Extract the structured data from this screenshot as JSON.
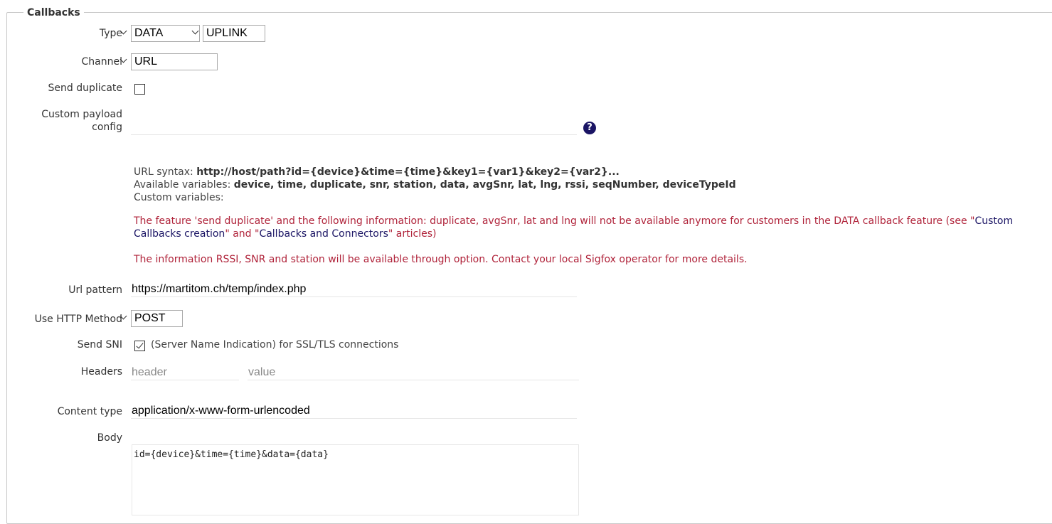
{
  "section": {
    "title": "Callbacks"
  },
  "type": {
    "label": "Type",
    "value1": "DATA",
    "value2": "UPLINK"
  },
  "channel": {
    "label": "Channel",
    "value": "URL"
  },
  "send_duplicate": {
    "label": "Send duplicate",
    "checked": false
  },
  "custom_payload": {
    "label_line1": "Custom payload",
    "label_line2": "config",
    "value": "",
    "help_icon": "question-circle-icon",
    "help_glyph": "?"
  },
  "info": {
    "url_syntax_label": "URL syntax:",
    "url_syntax_value": "http://host/path?id={device}&time={time}&key1={var1}&key2={var2}...",
    "available_label": "Available variables:",
    "available_value": "device, time, duplicate, snr, station, data, avgSnr, lat, lng, rssi, seqNumber, deviceTypeId",
    "custom_label": "Custom variables:"
  },
  "warnings": {
    "w1_part1": "The feature 'send duplicate' and the following information: duplicate, avgSnr, lat and lng will not be available anymore for customers in the DATA callback feature (see \"",
    "w1_link1": "Custom Callbacks creation",
    "w1_part2": "\" and \"",
    "w1_link2": "Callbacks and Connectors",
    "w1_part3": "\" articles)",
    "w2": "The information RSSI, SNR and station will be available through option. Contact your local Sigfox operator for more details."
  },
  "url_pattern": {
    "label": "Url pattern",
    "value": "https://martitom.ch/temp/index.php"
  },
  "http_method": {
    "label": "Use HTTP Method",
    "value": "POST"
  },
  "send_sni": {
    "label": "Send SNI",
    "checked": true,
    "description": "(Server Name Indication) for SSL/TLS connections"
  },
  "headers": {
    "label": "Headers",
    "header_placeholder": "header",
    "value_placeholder": "value"
  },
  "content_type": {
    "label": "Content type",
    "value": "application/x-www-form-urlencoded"
  },
  "body": {
    "label": "Body",
    "value": "id={device}&time={time}&data={data}"
  },
  "colors": {
    "warning": "#b0233a",
    "link": "#1a1464",
    "help_icon": "#1a1464"
  }
}
